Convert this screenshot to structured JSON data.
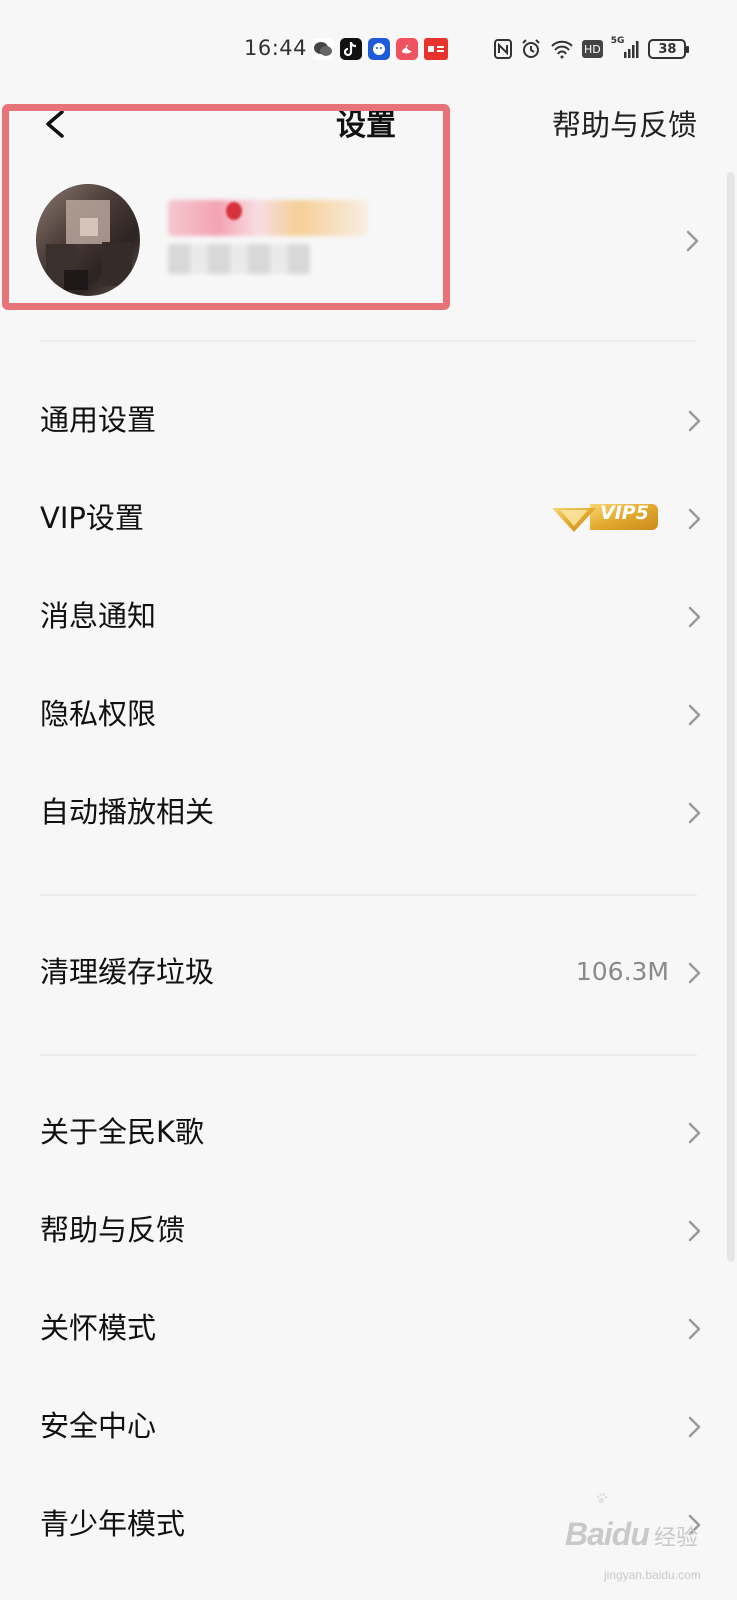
{
  "status_bar": {
    "time": "16:44",
    "network": "5G",
    "hd": "HD",
    "battery": "38",
    "app_icons": [
      "wechat-icon",
      "douyin-icon",
      "qq-icon",
      "swan-icon",
      "news-app-icon"
    ]
  },
  "header": {
    "title": "设置",
    "help_link": "帮助与反馈"
  },
  "profile": {
    "nickname_blurred": true,
    "signature_blurred": true
  },
  "settings_groups": [
    {
      "items": [
        {
          "label": "通用设置"
        },
        {
          "label": "VIP设置",
          "badge": "VIP5"
        },
        {
          "label": "消息通知"
        },
        {
          "label": "隐私权限"
        },
        {
          "label": "自动播放相关"
        }
      ]
    },
    {
      "items": [
        {
          "label": "清理缓存垃圾",
          "value": "106.3M"
        }
      ]
    },
    {
      "items": [
        {
          "label": "关于全民K歌"
        },
        {
          "label": "帮助与反馈"
        },
        {
          "label": "关怀模式"
        },
        {
          "label": "安全中心"
        },
        {
          "label": "青少年模式"
        }
      ]
    }
  ],
  "watermark": {
    "text": "Baidu",
    "suffix": "经验",
    "url": "jingyan.baidu.com"
  },
  "colors": {
    "background": "#f7f7f7",
    "highlight_border": "#e57378",
    "vip_gold": "#e7b53b",
    "value_gray": "#8a8a8a"
  }
}
